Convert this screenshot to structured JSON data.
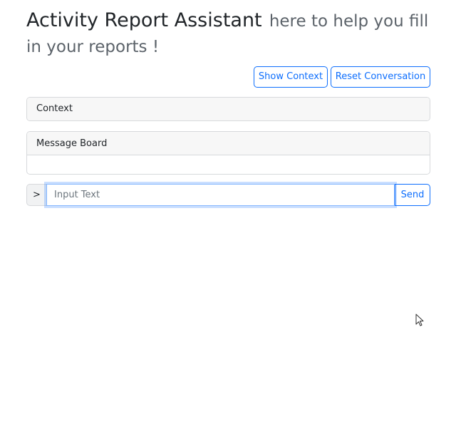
{
  "header": {
    "title": "Activity Report Assistant",
    "subtitle": "here to help you fill in your reports !"
  },
  "toolbar": {
    "show_context_label": "Show Context",
    "reset_conversation_label": "Reset Conversation"
  },
  "context_panel": {
    "header": "Context"
  },
  "message_board": {
    "header": "Message Board"
  },
  "input_bar": {
    "prompt": ">",
    "placeholder": "Input Text",
    "value": "",
    "send_label": "Send"
  },
  "colors": {
    "accent": "#0d6efd",
    "focus_border": "#86b7fe",
    "card_header_bg": "#f7f7f7",
    "subtitle": "#5c636a"
  },
  "icons": {
    "pointer": "mouse-pointer-icon"
  }
}
